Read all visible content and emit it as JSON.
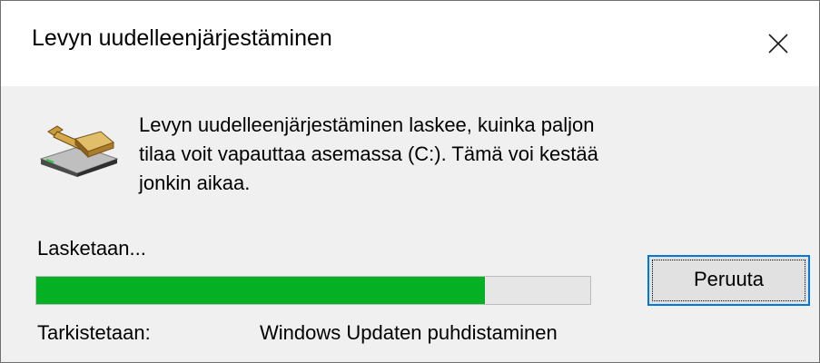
{
  "window": {
    "title": "Levyn uudelleenjärjestäminen",
    "close_icon": "close-icon"
  },
  "dialog": {
    "icon": "disk-cleanup-icon",
    "message_lines": [
      "Levyn uudelleenjärjestäminen laskee, kuinka paljon",
      "tilaa voit vapauttaa asemassa  (C:). Tämä voi kestää",
      "jonkin aikaa."
    ],
    "status_text": "Lasketaan...",
    "progress_fraction": 0.81,
    "cancel_label": "Peruuta",
    "checking_label": "Tarkistetaan:",
    "checking_value": "Windows Updaten puhdistaminen"
  },
  "colors": {
    "progress_fill": "#06b025",
    "progress_track": "#e6e6e6",
    "focus_border": "#0078d7",
    "content_bg": "#f0f0f0"
  }
}
